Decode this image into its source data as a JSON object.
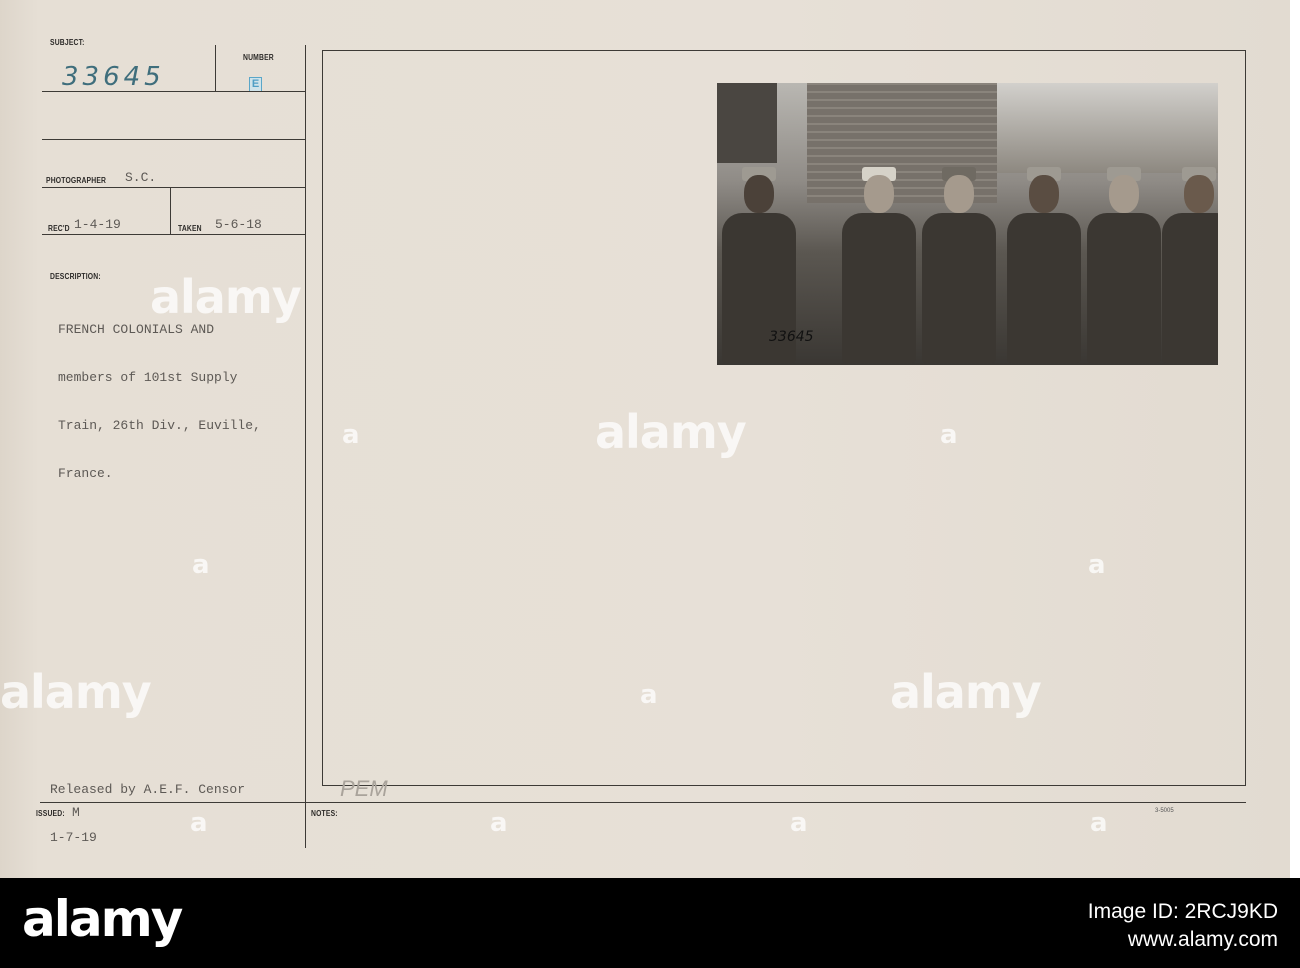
{
  "card": {
    "subject_label": "SUBJECT:",
    "subject_value": "33645",
    "number_label": "NUMBER",
    "number_stamp": "E",
    "photographer_label": "PHOTOGRAPHER",
    "photographer_value": "S.C.",
    "recd_label": "REC'D",
    "recd_value": "1-4-19",
    "taken_label": "TAKEN",
    "taken_value": "5-6-18",
    "description_label": "DESCRIPTION:",
    "description_lines": [
      "FRENCH COLONIALS AND",
      "members of 101st Supply",
      "Train, 26th Div., Euville,",
      "France."
    ],
    "released_lines": [
      "Released by A.E.F. Censor",
      "1-7-19"
    ],
    "issued_label": "ISSUED:",
    "issued_value": "M",
    "notes_label": "NOTES:",
    "notes_handwriting": "PEM",
    "form_number": "3-5005",
    "photo_number": "33645"
  },
  "watermark": {
    "text": "alamy",
    "letter": "a"
  },
  "footer": {
    "logo": "alamy",
    "image_id": "Image ID: 2RCJ9KD",
    "url": "www.alamy.com"
  }
}
